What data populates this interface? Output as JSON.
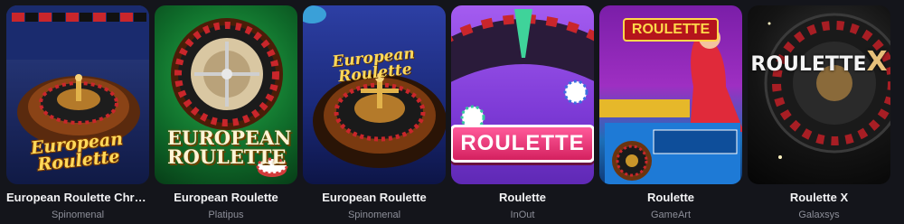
{
  "games": [
    {
      "title": "European Roulette Christ...",
      "provider": "Spinomenal",
      "logo": "European Roulette"
    },
    {
      "title": "European Roulette",
      "provider": "Platipus",
      "logo": "EUROPEAN ROULETTE"
    },
    {
      "title": "European Roulette",
      "provider": "Spinomenal",
      "logo": "European Roulette"
    },
    {
      "title": "Roulette",
      "provider": "InOut",
      "logo": "ROULETTE"
    },
    {
      "title": "Roulette",
      "provider": "GameArt",
      "logo": "ROULETTE"
    },
    {
      "title": "Roulette X",
      "provider": "Galaxsys",
      "logo": "ROULETTE",
      "logo_suffix": "X"
    }
  ],
  "colors": {
    "background": "#14151b",
    "title": "#f2f2f4",
    "provider": "#8d8f99"
  }
}
